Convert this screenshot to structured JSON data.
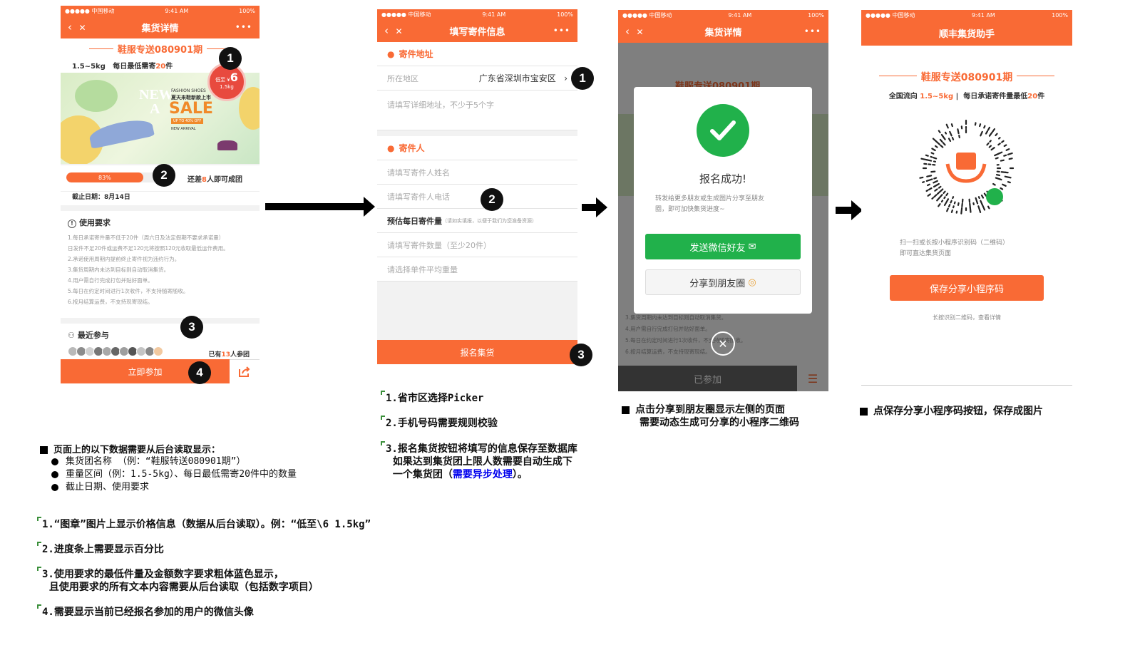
{
  "status": {
    "carrier": "●●●●● 中国移动",
    "time": "9:41 AM",
    "battery": "100%"
  },
  "screen1": {
    "nav_title": "集货详情",
    "more": "•••",
    "back": "‹",
    "close": "✕",
    "group_name": "鞋服专送080901期",
    "weight": "1.5~5kg",
    "daily_prefix": "每日最低需寄",
    "daily_num": "20",
    "daily_suffix": "件",
    "stamp_top": "低至 ¥",
    "stamp_price": "6",
    "stamp_weight": "1.5kg",
    "banner": {
      "brand": "FASHION SHOES",
      "subtitle": "夏天来鞋新款上市",
      "sale": "SALE",
      "new": "NEW",
      "a": "A",
      "up": "UP TO 40% OFF",
      "arrival": "NEW ARRIVAL"
    },
    "progress": {
      "label": "83%",
      "value": 0.83
    },
    "remain_prefix": "还差",
    "remain_num": "8",
    "remain_suffix": "人即可成团",
    "deadline": "截止日期：8月14日",
    "req_title": "使用要求",
    "req_lines": [
      "1.每日承诺寄件量不低于20件（周六日及法定假期不要求承诺量）",
      "日发件不足20件或运费不足120元将按照120元收取最低运作费用。",
      "2.承诺使用周期内提前终止寄件视为违约行为。",
      "3.集货周期内未达到目标则自动取消集货。",
      "4.用户需自行完成打包并贴好面单。",
      "5.每日在约定时间进行1次收件，不支持随寄随收。",
      "6.按月结算运费，不支持现寄现结。"
    ],
    "recent_title": "最近参与",
    "joined_prefix": "已有",
    "joined_num": "13",
    "joined_suffix": "人参团",
    "join_btn": "立即参加"
  },
  "screen2": {
    "nav_title": "填写寄件信息",
    "addr_title": "寄件地址",
    "region_label": "所在地区",
    "region_value": "广东省深圳市宝安区",
    "detail_ph": "请填写详细地址，不少于5个字",
    "sender_title": "寄件人",
    "name_ph": "请填写寄件人姓名",
    "phone_ph": "请填写寄件人电话",
    "est_label": "预估每日寄件量",
    "est_hint": "（请如实填报，以便于我们为您准备资源）",
    "qty_ph": "请填写寄件数量（至少20件）",
    "weight_ph": "请选择单件平均重量",
    "submit": "报名集货"
  },
  "screen3": {
    "nav_title": "集货详情",
    "bg_title": "鞋服专送080901期",
    "success_title": "报名成功!",
    "success_desc1": "转发给更多朋友或生成图片分享至朋友",
    "success_desc2": "圈，即可加快集货进度~",
    "wechat_btn": "发送微信好友",
    "moments_btn": "分享到朋友圈",
    "joined": "已参加",
    "bg_req": [
      "3.集货周期内未达到目标则自动取消集货。",
      "4.用户需自行完成打包并贴好面单。",
      "5.每日在约定时间进行1次收件，不支持随寄随收。",
      "6.按月结算运费，不支持现寄现结。"
    ]
  },
  "screen4": {
    "nav_title": "顺丰集货助手",
    "group_name": "鞋服专送080901期",
    "flow_prefix": "全国流向",
    "flow_weight": "1.5~5kg",
    "flow_sep": "|",
    "flow_mid": "每日承诺寄件量最低",
    "flow_num": "20",
    "flow_suffix": "件",
    "scan1": "扫一扫或长按小程序识别码（二维码）",
    "scan2": "即可直达集货页面",
    "save_btn": "保存分享小程序码",
    "hint": "长按识别二维码，查看详情"
  },
  "markers": [
    "1",
    "2",
    "3",
    "4"
  ],
  "notes": {
    "n1_title": "页面上的以下数据需要从后台读取显示：",
    "n1_items": [
      "集货团名称 （例：“鞋服转送080901期”）",
      "重量区间（例：1.5-5kg）、每日最低需寄20件中的数量",
      "截止日期、使用要求"
    ],
    "left": [
      "1.“图章”图片上显示价格信息（数据从后台读取）。例：“低至\\6 1.5kg”",
      "2.进度条上需要显示百分比",
      "3.使用要求的最低件量及金额数字要求粗体蓝色显示，",
      "  且使用要求的所有文本内容需要从后台读取（包括数字项目）",
      "4.需要显示当前已经报名参加的用户的微信头像"
    ],
    "mid": [
      "1.省市区选择Picker",
      "2.手机号码需要规则校验",
      "3.报名集货按钮将填写的信息保存至数据库",
      "  如果达到集货团上限人数需要自动生成下",
      "  一个集货团（",
      "需要异步处理",
      "）。"
    ],
    "s3_1": "点击分享到朋友圈显示左侧的页面",
    "s3_2": "需要动态生成可分享的小程序二维码",
    "s4": "点保存分享小程序码按钮，保存成图片"
  },
  "colors": {
    "accent": "#f96a35",
    "wechat": "#21b14b",
    "link": "#0000ee"
  }
}
